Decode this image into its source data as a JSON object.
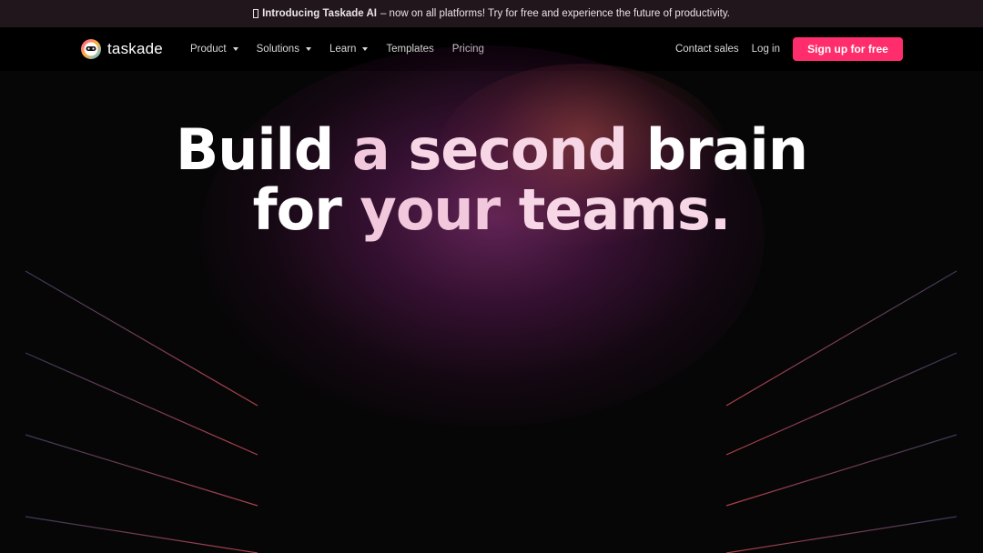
{
  "banner": {
    "icon": "sparkle-icon",
    "highlight": "Introducing Taskade AI",
    "text": "– now on all platforms! Try for free and experience the future of productivity."
  },
  "nav": {
    "logo_text": "taskade",
    "menu": [
      {
        "label": "Product",
        "has_dropdown": true
      },
      {
        "label": "Solutions",
        "has_dropdown": true
      },
      {
        "label": "Learn",
        "has_dropdown": true
      },
      {
        "label": "Templates",
        "has_dropdown": false
      },
      {
        "label": "Pricing",
        "has_dropdown": false
      }
    ],
    "contact_sales": "Contact sales",
    "login": "Log in",
    "signup": "Sign up for free"
  },
  "hero": {
    "line1": [
      "Build",
      "a",
      "second",
      "brain"
    ],
    "line2": [
      "for",
      "your",
      "teams."
    ]
  },
  "colors": {
    "accent": "#ff2d6b",
    "banner_bg": "#22161d",
    "page_bg": "#060606"
  }
}
